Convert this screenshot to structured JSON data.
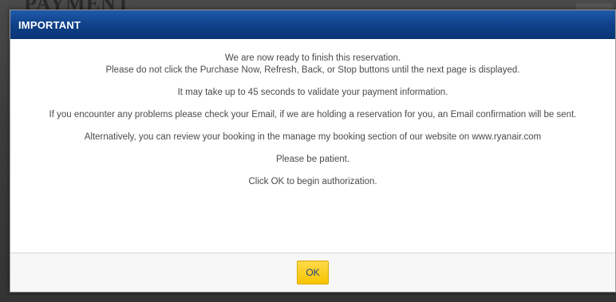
{
  "backdrop": {
    "heading_fragment": "PAYMENT"
  },
  "dialog": {
    "title": "IMPORTANT",
    "message": {
      "line1": "We are now ready to finish this reservation.",
      "line2": "Please do not click the Purchase Now, Refresh, Back, or Stop buttons until the next page is displayed.",
      "line3": "It may take up to 45 seconds to validate your payment information.",
      "line4": "If you encounter any problems please check your Email, if we are holding a reservation for you, an Email confirmation will be sent.",
      "line5": "Alternatively, you can review your booking in the manage my booking section of our website on www.ryanair.com",
      "line6": "Please be patient.",
      "line7": "Click OK to begin authorization."
    },
    "ok_label": "OK"
  },
  "colors": {
    "title_bar": "#0e3f86",
    "ok_button": "#f5c400",
    "ok_text": "#1f3f7a"
  }
}
